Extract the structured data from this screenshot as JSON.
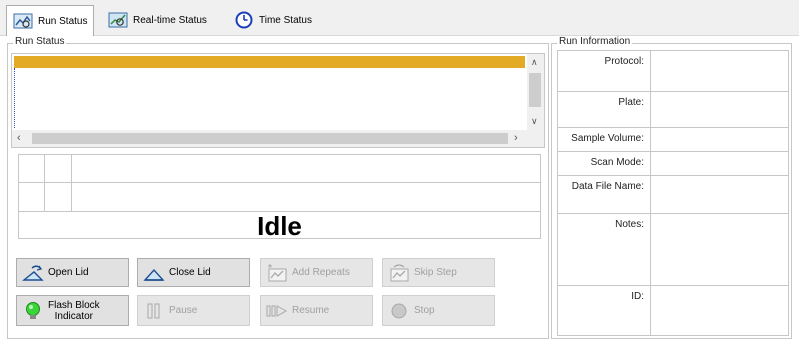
{
  "tabs": [
    {
      "label": "Run Status",
      "icon": "run-status-icon",
      "active": true
    },
    {
      "label": "Real-time Status",
      "icon": "realtime-status-icon",
      "active": false
    },
    {
      "label": "Time Status",
      "icon": "clock-icon",
      "active": false
    }
  ],
  "run_status": {
    "title": "Run Status",
    "state_text": "Idle",
    "highlight_color": "#e3aa26"
  },
  "buttons": {
    "open_lid": "Open Lid",
    "close_lid": "Close Lid",
    "add_repeats": "Add Repeats",
    "skip_step": "Skip Step",
    "flash_block_line1": "Flash Block",
    "flash_block_line2": "Indicator",
    "pause": "Pause",
    "resume": "Resume",
    "stop": "Stop"
  },
  "run_information": {
    "title": "Run Information",
    "fields": [
      {
        "label": "Protocol:",
        "value": ""
      },
      {
        "label": "Plate:",
        "value": ""
      },
      {
        "label": "Sample Volume:",
        "value": ""
      },
      {
        "label": "Scan Mode:",
        "value": ""
      },
      {
        "label": "Data File Name:",
        "value": ""
      },
      {
        "label": "Notes:",
        "value": ""
      },
      {
        "label": "ID:",
        "value": ""
      }
    ]
  }
}
